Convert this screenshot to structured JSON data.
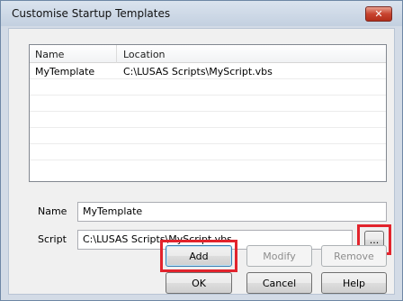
{
  "window": {
    "title": "Customise Startup Templates",
    "close_glyph": "✕"
  },
  "list": {
    "columns": [
      "Name",
      "Location"
    ],
    "rows": [
      {
        "name": "MyTemplate",
        "location": "C:\\LUSAS Scripts\\MyScript.vbs"
      }
    ]
  },
  "form": {
    "name_label": "Name",
    "name_value": "MyTemplate",
    "script_label": "Script",
    "script_value": "C:\\LUSAS Scripts\\MyScript.vbs",
    "browse_label": "..."
  },
  "buttons": {
    "add": "Add",
    "modify": "Modify",
    "remove": "Remove",
    "ok": "OK",
    "cancel": "Cancel",
    "help": "Help"
  },
  "colors": {
    "highlight": "#e2242d"
  }
}
